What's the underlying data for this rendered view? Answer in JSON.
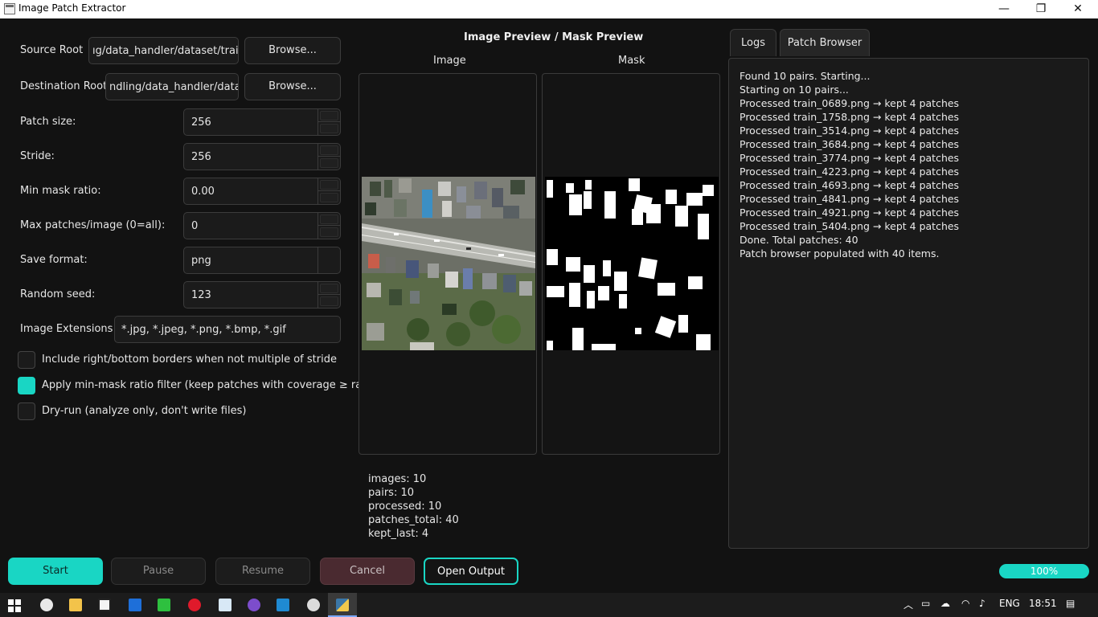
{
  "window": {
    "title": "Image Patch Extractor",
    "controls": {
      "minimize": "—",
      "maximize": "❐",
      "close": "✕"
    }
  },
  "form": {
    "source_root_label": "Source Root",
    "source_root_value": "ıg/data_handler/dataset/train",
    "dest_root_label": "Destination Root",
    "dest_root_value": "ndling/data_handler/data",
    "browse_label": "Browse...",
    "patch_size_label": "Patch size:",
    "patch_size_value": "256",
    "stride_label": "Stride:",
    "stride_value": "256",
    "min_mask_label": "Min mask ratio:",
    "min_mask_value": "0.00",
    "max_patches_label": "Max patches/image (0=all):",
    "max_patches_value": "0",
    "save_format_label": "Save format:",
    "save_format_value": "png",
    "random_seed_label": "Random seed:",
    "random_seed_value": "123",
    "extensions_label": "Image Extensions:",
    "extensions_value": "*.jpg, *.jpeg, *.png, *.bmp, *.gif",
    "check_borders": {
      "label": "Include right/bottom borders when not multiple of stride",
      "checked": false
    },
    "check_minmask": {
      "label": "Apply min-mask ratio filter (keep patches with coverage ≥ ratio)",
      "checked": true
    },
    "check_dryrun": {
      "label": "Dry-run (analyze only, don't write files)",
      "checked": false
    }
  },
  "preview": {
    "title": "Image Preview / Mask Preview",
    "image_label": "Image",
    "mask_label": "Mask",
    "stats": [
      "images: 10",
      "pairs: 10",
      "processed: 10",
      "patches_total: 40",
      "kept_last: 4"
    ]
  },
  "tabs": {
    "logs": "Logs",
    "patch_browser": "Patch Browser",
    "active": "logs"
  },
  "logs": [
    "Found 10 pairs. Starting...",
    "Starting on 10 pairs...",
    "Processed train_0689.png → kept 4 patches",
    "Processed train_1758.png → kept 4 patches",
    "Processed train_3514.png → kept 4 patches",
    "Processed train_3684.png → kept 4 patches",
    "Processed train_3774.png → kept 4 patches",
    "Processed train_4223.png → kept 4 patches",
    "Processed train_4693.png → kept 4 patches",
    "Processed train_4841.png → kept 4 patches",
    "Processed train_4921.png → kept 4 patches",
    "Processed train_5404.png → kept 4 patches",
    "Done. Total patches: 40",
    "Patch browser populated with 40 items."
  ],
  "buttons": {
    "start": "Start",
    "pause": "Pause",
    "resume": "Resume",
    "cancel": "Cancel",
    "open_output": "Open Output"
  },
  "progress": {
    "value": 1.0,
    "label": "100%"
  },
  "colors": {
    "accent": "#19d6c4",
    "cancel": "#4a2a30",
    "background": "#121212"
  },
  "taskbar": {
    "icons": [
      "windows-start-icon",
      "paint-icon",
      "file-explorer-icon",
      "winrar-icon",
      "maps-icon",
      "dictionary-icon",
      "opera-icon",
      "notepad-icon",
      "github-desktop-icon",
      "vscode-icon",
      "obs-icon",
      "python-icon"
    ],
    "tray_language": "ENG",
    "tray_time": "18:51"
  }
}
